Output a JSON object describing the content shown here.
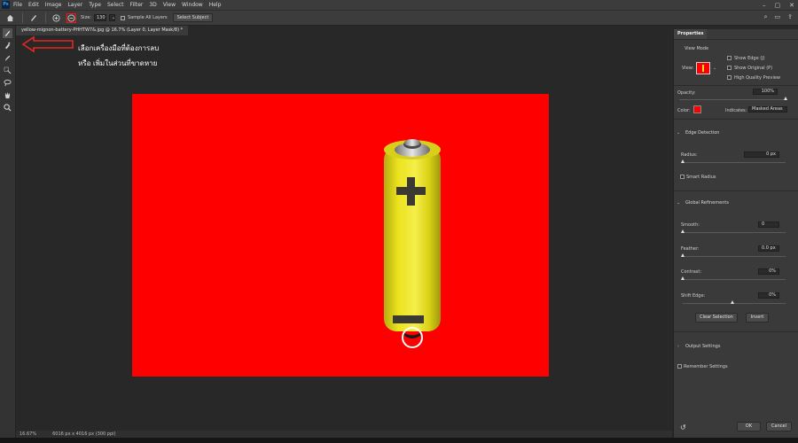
{
  "menubar": {
    "logo": "Ps",
    "items": [
      "File",
      "Edit",
      "Image",
      "Layer",
      "Type",
      "Select",
      "Filter",
      "3D",
      "View",
      "Window",
      "Help"
    ],
    "window_controls": [
      "–",
      "▢",
      "✕"
    ]
  },
  "options": {
    "size_label": "Size:",
    "size_value": "130",
    "sample_label": "Sample All Layers",
    "select_subject_label": "Select Subject"
  },
  "document": {
    "tab_title": "yellow-mignon-battery-PHHTW7&.jpg @ 16.7% (Layer 0, Layer Mask/8) *",
    "zoom": "16.67%",
    "info": "6016 px x 4016 px (300 ppi)"
  },
  "annotation": {
    "line1": "เลือกเครื่องมือที่ต้องการลบ",
    "line2": "หรือ เพิ่มในส่วนที่ขาดหาย"
  },
  "properties": {
    "tab_label": "Properties",
    "view_mode_label": "View Mode",
    "view_label": "View:",
    "show_edge": "Show Edge (J)",
    "show_original": "Show Original (P)",
    "high_quality": "High Quality Preview",
    "opacity_label": "Opacity:",
    "opacity_value": "100%",
    "opacity_fraction": 1.0,
    "color_label": "Color:",
    "indicates_label": "Indicates:",
    "indicates_value": "Masked Areas",
    "edge_detection": "Edge Detection",
    "radius_label": "Radius:",
    "radius_value": "0 px",
    "smart_radius": "Smart Radius",
    "global_refinements": "Global Refinements",
    "smooth_label": "Smooth:",
    "smooth_value": "0",
    "feather_label": "Feather:",
    "feather_value": "0.0 px",
    "contrast_label": "Contrast:",
    "contrast_value": "0%",
    "shift_edge_label": "Shift Edge:",
    "shift_edge_value": "0%",
    "clear_selection": "Clear Selection",
    "invert": "Invert",
    "output_settings": "Output Settings",
    "remember_settings": "Remember Settings",
    "ok": "OK",
    "cancel": "Cancel"
  },
  "colors": {
    "overlay_red": "#ff0000",
    "annotation_red": "#e8261d",
    "battery_yellow": "#e8e019"
  }
}
